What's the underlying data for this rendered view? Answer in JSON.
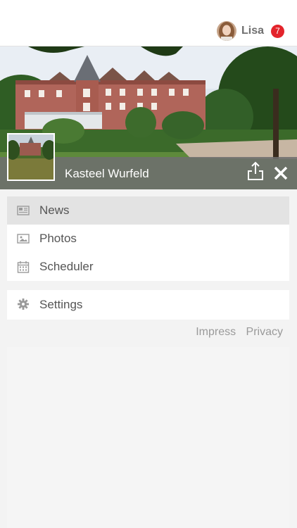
{
  "user": {
    "name": "Lisa",
    "notifications": "7"
  },
  "header": {
    "place_name": "Kasteel Wurfeld"
  },
  "menu": {
    "group1": [
      {
        "label": "News",
        "icon": "newspaper-icon",
        "active": true
      },
      {
        "label": "Photos",
        "icon": "image-icon",
        "active": false
      },
      {
        "label": "Scheduler",
        "icon": "calendar-icon",
        "active": false
      }
    ],
    "group2": [
      {
        "label": "Settings",
        "icon": "gear-icon",
        "active": false
      }
    ]
  },
  "footer": {
    "impress": "Impress",
    "privacy": "Privacy"
  },
  "colors": {
    "badge": "#e3242b",
    "active_item": "#e3e3e3",
    "title_overlay": "#6e6e6e"
  }
}
